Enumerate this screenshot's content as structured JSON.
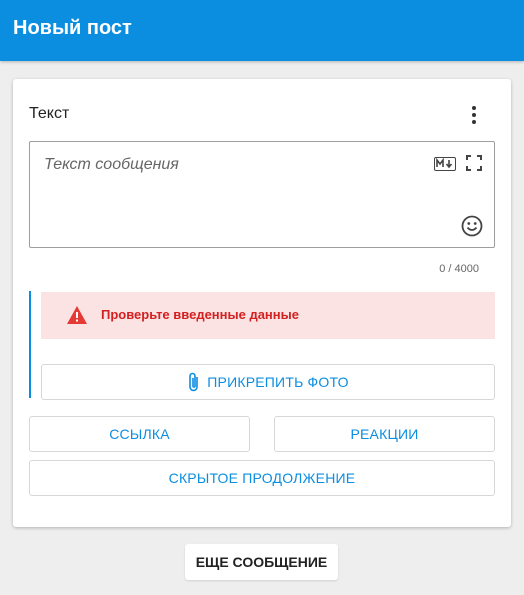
{
  "appbar": {
    "title": "Новый пост",
    "color": "#0b8ee0"
  },
  "card": {
    "section_title": "Текст",
    "editor": {
      "placeholder": "Текст сообщения",
      "counter": "0 / 4000",
      "icons": [
        "markdown-icon",
        "fullscreen-icon",
        "emoji-icon"
      ]
    },
    "alert": {
      "text": "Проверьте введенные данные",
      "color": "#d32020",
      "background": "#fbe3e3"
    },
    "buttons": {
      "attach_photo": "ПРИКРЕПИТЬ ФОТО",
      "link": "ССЫЛКА",
      "reactions": "РЕАКЦИИ",
      "hidden_continuation": "СКРЫТОЕ ПРОДОЛЖЕНИЕ"
    }
  },
  "more_message": "ЕЩЕ СООБЩЕНИЕ"
}
